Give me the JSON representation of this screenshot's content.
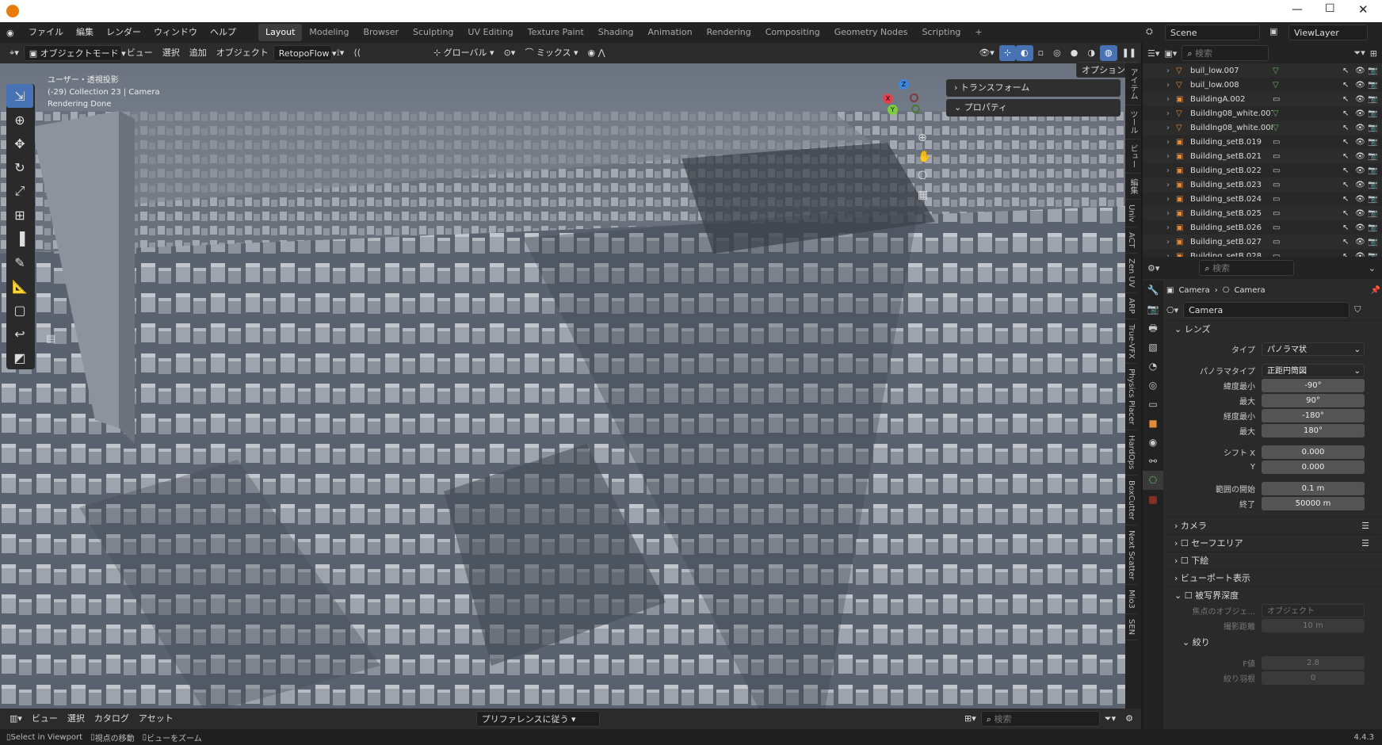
{
  "menu": [
    "ファイル",
    "編集",
    "レンダー",
    "ウィンドウ",
    "ヘルプ"
  ],
  "workspaces": [
    "Layout",
    "Modeling",
    "Browser",
    "Sculpting",
    "UV Editing",
    "Texture Paint",
    "Shading",
    "Animation",
    "Rendering",
    "Compositing",
    "Geometry Nodes",
    "Scripting"
  ],
  "active_workspace": "Layout",
  "scene": "Scene",
  "view_layer": "ViewLayer",
  "viewport_header": {
    "mode": "オブジェクトモード",
    "view": "ビュー",
    "select": "選択",
    "add": "追加",
    "object": "オブジェクト",
    "retopoflow": "RetopoFlow",
    "orientation": "グローバル",
    "mix": "ミックス",
    "options": "オプション"
  },
  "viewport_overlay": {
    "perspective": "ユーザー・透視投影",
    "collection": "(-29) Collection 23 | Camera",
    "status": "Rendering Done"
  },
  "npanel": {
    "transform": "トランスフォーム",
    "properties": "プロパティ"
  },
  "vertical_tabs": [
    "アイテム",
    "ツール",
    "ビュー",
    "編集",
    "Univ",
    "ACT",
    "Zen UV",
    "ARP",
    "True-VFX",
    "Physics Placer",
    "HardOps",
    "BoxCutter",
    "Next Scatter",
    "Mio3",
    "SEN"
  ],
  "gizmo": {
    "x": "X",
    "y": "Y",
    "z": "Z"
  },
  "outliner_search": "検索",
  "outliner": [
    "buil_low.007",
    "buil_low.008",
    "BuildingA.002",
    "Buildlng08_white.007",
    "Buildlng08_white.008",
    "Building_setB.019",
    "Building_setB.021",
    "Building_setB.022",
    "Building_setB.023",
    "Building_setB.024",
    "Building_setB.025",
    "Building_setB.026",
    "Building_setB.027",
    "Building_setB.028"
  ],
  "properties": {
    "search": "検索",
    "breadcrumb_a": "Camera",
    "breadcrumb_b": "Camera",
    "datablock": "Camera",
    "lens_section": "レンズ",
    "type_label": "タイプ",
    "type_value": "パノラマ状",
    "pano_label": "パノラマタイプ",
    "pano_value": "正距円筒図",
    "lat_min_label": "緯度最小",
    "lat_min": "-90°",
    "lat_max_label": "最大",
    "lat_max": "90°",
    "lon_min_label": "経度最小",
    "lon_min": "-180°",
    "lon_max_label": "最大",
    "lon_max": "180°",
    "shift_x_label": "シフト X",
    "shift_x": "0.000",
    "shift_y_label": "Y",
    "shift_y": "0.000",
    "clip_start_label": "範囲の開始",
    "clip_start": "0.1 m",
    "clip_end_label": "終了",
    "clip_end": "50000 m",
    "sec_camera": "カメラ",
    "sec_safe": "セーフエリア",
    "sec_bg": "下絵",
    "sec_vpdisp": "ビューポート表示",
    "sec_dof": "被写界深度",
    "focus_obj_label": "焦点のオブジェ...",
    "focus_obj_placeholder": "オブジェクト",
    "focus_dist_label": "撮影距離",
    "focus_dist": "10 m",
    "aperture": "絞り",
    "fstop_label": "F値",
    "fstop": "2.8",
    "blades_label": "絞り羽根",
    "blades": "0"
  },
  "footer": {
    "view": "ビュー",
    "select": "選択",
    "catalog": "カタログ",
    "asset": "アセット",
    "pref": "プリファレンスに従う",
    "search": "検索"
  },
  "status_bar": {
    "select": "Select in Viewport",
    "move": "視点の移動",
    "zoom": "ビューをズーム",
    "version": "4.4.3"
  },
  "colors": {
    "accent": "#4772b3",
    "object_orange": "#e08a3a",
    "mesh_green": "#63b35c"
  }
}
